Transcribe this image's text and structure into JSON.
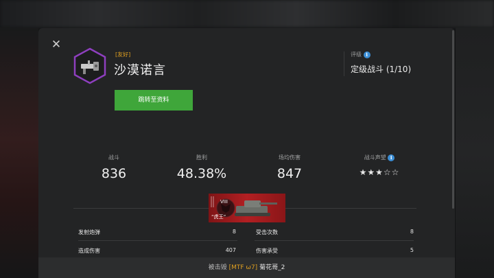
{
  "header": {
    "tag": "[友好]",
    "player_name": "沙漠诺言",
    "profile_button": "跳转至资料"
  },
  "rating": {
    "label": "评级",
    "value": "定级战斗 (1/10)"
  },
  "stats": [
    {
      "label": "战斗",
      "value": "836"
    },
    {
      "label": "胜利",
      "value": "48.38%"
    },
    {
      "label": "场均伤害",
      "value": "847"
    }
  ],
  "reputation": {
    "label": "战斗声望",
    "stars": "★★★☆☆",
    "stars_filled": 3,
    "stars_total": 5
  },
  "tank": {
    "name": "“虎王”",
    "tier": "VIII"
  },
  "details": {
    "shots_fired": {
      "label": "发射炮弹",
      "value": "8"
    },
    "hits_received": {
      "label": "受击次数",
      "value": "8"
    },
    "damage_dealt": {
      "label": "造成伤害",
      "value": "407"
    },
    "damage_received": {
      "label": "伤害承受",
      "value": "5"
    }
  },
  "footer": {
    "prefix": "被击毁",
    "clan": "[MTF ω7]",
    "killer": "菊花哥_2"
  },
  "colors": {
    "accent_green": "#3fa63a",
    "tag_orange": "#e0a020",
    "emblem_purple": "#8e3fbf",
    "info_blue": "#3b8ed6",
    "tank_red": "#b21f22"
  }
}
